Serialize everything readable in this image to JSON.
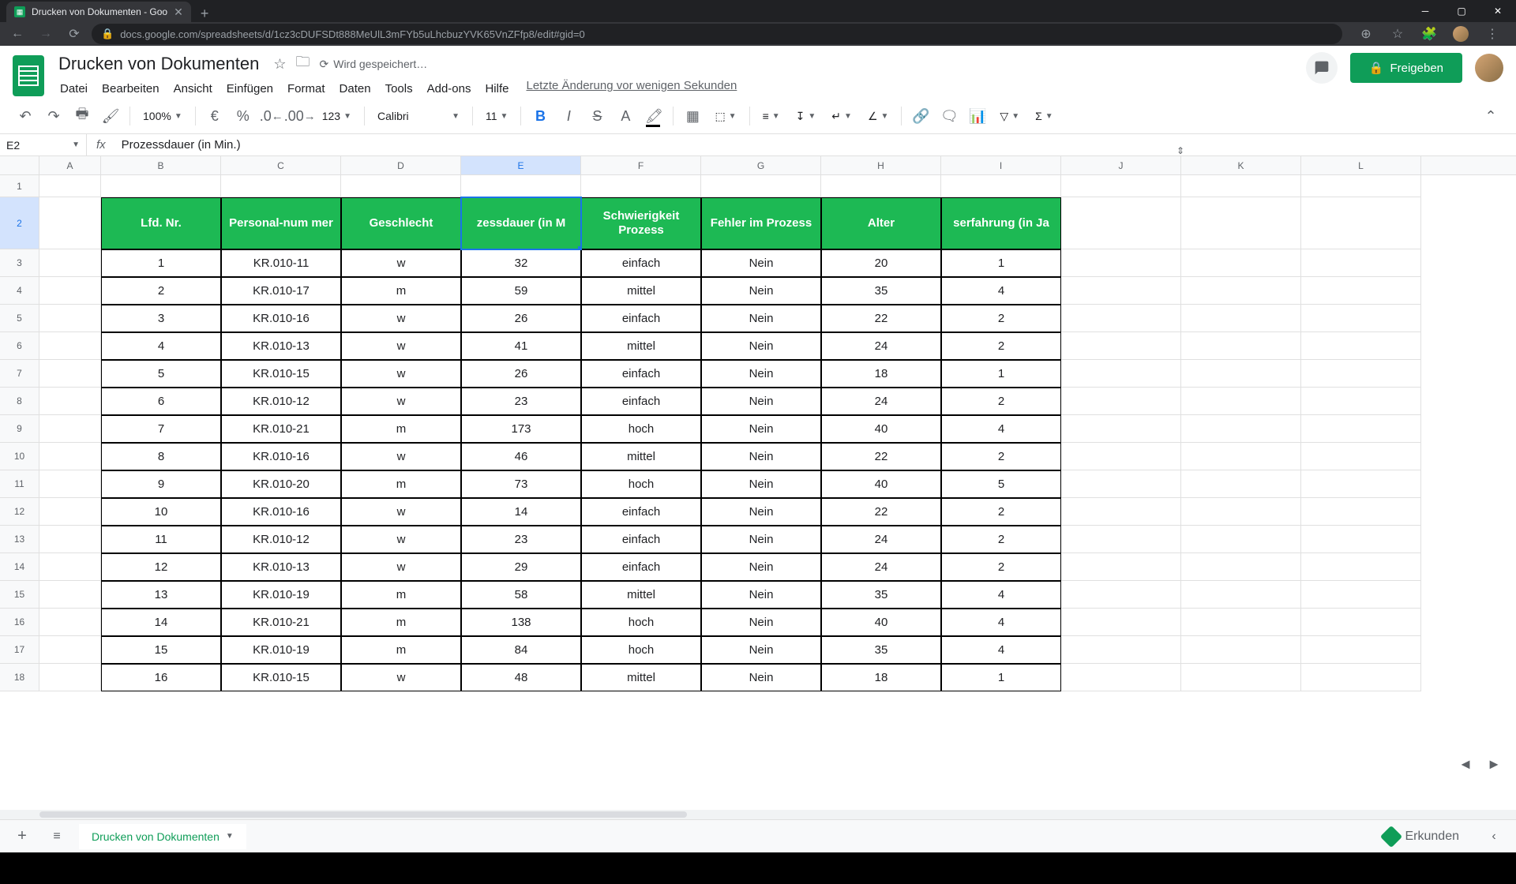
{
  "browser": {
    "tab_title": "Drucken von Dokumenten - Goo",
    "url": "docs.google.com/spreadsheets/d/1cz3cDUFSDt888MeUlL3mFYb5uLhcbuzYVK65VnZFfp8/edit#gid=0"
  },
  "doc": {
    "title": "Drucken von Dokumenten",
    "saving_status": "Wird gespeichert…",
    "last_edit": "Letzte Änderung vor wenigen Sekunden"
  },
  "menu": {
    "file": "Datei",
    "edit": "Bearbeiten",
    "view": "Ansicht",
    "insert": "Einfügen",
    "format": "Format",
    "data": "Daten",
    "tools": "Tools",
    "addons": "Add-ons",
    "help": "Hilfe"
  },
  "share_label": "Freigeben",
  "toolbar": {
    "zoom": "100%",
    "currency": "€",
    "percent": "%",
    "dec_dec": ".0",
    "inc_dec": ".00",
    "num_format": "123",
    "font": "Calibri",
    "font_size": "11"
  },
  "name_box": "E2",
  "formula": "Prozessdauer (in Min.)",
  "columns": [
    "A",
    "B",
    "C",
    "D",
    "E",
    "F",
    "G",
    "H",
    "I",
    "J",
    "K",
    "L"
  ],
  "selected_col": "E",
  "selected_row": 2,
  "headers": {
    "B": "Lfd. Nr.",
    "C": "Personal-num mer",
    "D": "Geschlecht",
    "E": "zessdauer (in M",
    "F": "Schwierigkeit Prozess",
    "G": "Fehler im Prozess",
    "H": "Alter",
    "I": "serfahrung (in Ja"
  },
  "rows": [
    {
      "n": "1",
      "p": "KR.010-11",
      "g": "w",
      "d": "32",
      "s": "einfach",
      "f": "Nein",
      "a": "20",
      "e": "1"
    },
    {
      "n": "2",
      "p": "KR.010-17",
      "g": "m",
      "d": "59",
      "s": "mittel",
      "f": "Nein",
      "a": "35",
      "e": "4"
    },
    {
      "n": "3",
      "p": "KR.010-16",
      "g": "w",
      "d": "26",
      "s": "einfach",
      "f": "Nein",
      "a": "22",
      "e": "2"
    },
    {
      "n": "4",
      "p": "KR.010-13",
      "g": "w",
      "d": "41",
      "s": "mittel",
      "f": "Nein",
      "a": "24",
      "e": "2"
    },
    {
      "n": "5",
      "p": "KR.010-15",
      "g": "w",
      "d": "26",
      "s": "einfach",
      "f": "Nein",
      "a": "18",
      "e": "1"
    },
    {
      "n": "6",
      "p": "KR.010-12",
      "g": "w",
      "d": "23",
      "s": "einfach",
      "f": "Nein",
      "a": "24",
      "e": "2"
    },
    {
      "n": "7",
      "p": "KR.010-21",
      "g": "m",
      "d": "173",
      "s": "hoch",
      "f": "Nein",
      "a": "40",
      "e": "4"
    },
    {
      "n": "8",
      "p": "KR.010-16",
      "g": "w",
      "d": "46",
      "s": "mittel",
      "f": "Nein",
      "a": "22",
      "e": "2"
    },
    {
      "n": "9",
      "p": "KR.010-20",
      "g": "m",
      "d": "73",
      "s": "hoch",
      "f": "Nein",
      "a": "40",
      "e": "5"
    },
    {
      "n": "10",
      "p": "KR.010-16",
      "g": "w",
      "d": "14",
      "s": "einfach",
      "f": "Nein",
      "a": "22",
      "e": "2"
    },
    {
      "n": "11",
      "p": "KR.010-12",
      "g": "w",
      "d": "23",
      "s": "einfach",
      "f": "Nein",
      "a": "24",
      "e": "2"
    },
    {
      "n": "12",
      "p": "KR.010-13",
      "g": "w",
      "d": "29",
      "s": "einfach",
      "f": "Nein",
      "a": "24",
      "e": "2"
    },
    {
      "n": "13",
      "p": "KR.010-19",
      "g": "m",
      "d": "58",
      "s": "mittel",
      "f": "Nein",
      "a": "35",
      "e": "4"
    },
    {
      "n": "14",
      "p": "KR.010-21",
      "g": "m",
      "d": "138",
      "s": "hoch",
      "f": "Nein",
      "a": "40",
      "e": "4"
    },
    {
      "n": "15",
      "p": "KR.010-19",
      "g": "m",
      "d": "84",
      "s": "hoch",
      "f": "Nein",
      "a": "35",
      "e": "4"
    },
    {
      "n": "16",
      "p": "KR.010-15",
      "g": "w",
      "d": "48",
      "s": "mittel",
      "f": "Nein",
      "a": "18",
      "e": "1"
    }
  ],
  "sheet_tab": "Drucken von Dokumenten",
  "explore_label": "Erkunden"
}
